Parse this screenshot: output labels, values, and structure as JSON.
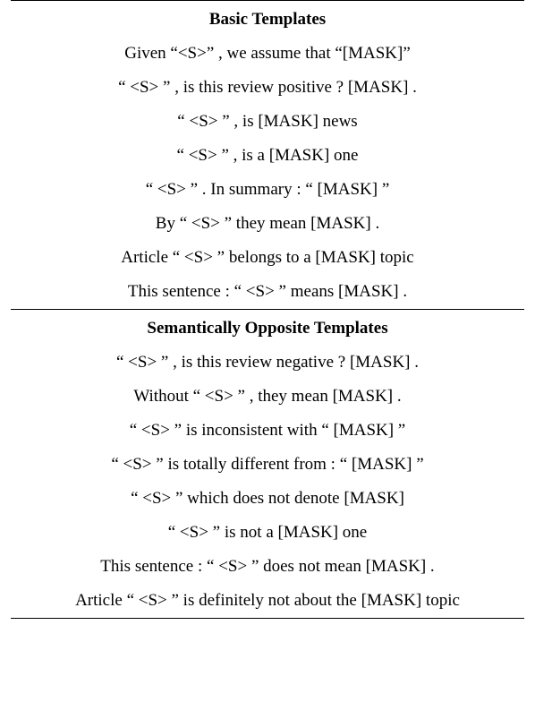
{
  "sections": {
    "basic": {
      "heading": "Basic Templates",
      "templates": [
        "Given “<S>” , we assume that “[MASK]”",
        "“ <S> ” , is this review positive ? [MASK] .",
        "“ <S> ” , is [MASK] news",
        "“ <S> ” , is a [MASK] one",
        "“ <S> ” . In summary : “ [MASK] ”",
        "By “ <S> ” they mean [MASK] .",
        "Article “ <S> ” belongs to a [MASK] topic",
        "This sentence : “ <S> ” means [MASK] ."
      ]
    },
    "opposite": {
      "heading": "Semantically Opposite Templates",
      "templates": [
        "“ <S> ” , is this review negative ? [MASK] .",
        "Without “ <S> ” , they mean [MASK] .",
        "“ <S> ” is inconsistent with “ [MASK] ”",
        "“ <S> ” is totally different from : “ [MASK] ”",
        "“ <S> ” which does not denote [MASK]",
        "“ <S> ” is not a [MASK] one",
        "This sentence : “ <S> ” does not mean [MASK] .",
        "Article “ <S> ” is definitely not about the [MASK] topic"
      ]
    }
  }
}
